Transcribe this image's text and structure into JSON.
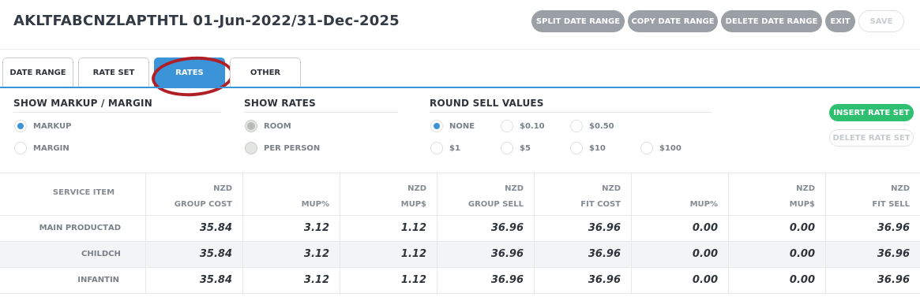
{
  "title": "AKLTFABCNZLAPTHTL 01-Jun-2022/31-Dec-2025",
  "actions": {
    "split": "SPLIT DATE RANGE",
    "copy": "COPY DATE RANGE",
    "delete": "DELETE DATE RANGE",
    "exit": "EXIT",
    "save": "SAVE"
  },
  "tabs": [
    "DATE RANGE",
    "RATE SET",
    "RATES",
    "OTHER"
  ],
  "active_tab": "RATES",
  "options": {
    "markup": {
      "heading": "SHOW MARKUP / MARGIN",
      "items": [
        "MARKUP",
        "MARGIN"
      ],
      "selected": "MARKUP"
    },
    "rates": {
      "heading": "SHOW RATES",
      "items": [
        "ROOM",
        "PER PERSON"
      ],
      "selected": "ROOM"
    },
    "round": {
      "heading": "ROUND SELL VALUES",
      "items": [
        "NONE",
        "$0.10",
        "$0.50",
        "$1",
        "$5",
        "$10",
        "$100"
      ],
      "selected": "NONE"
    }
  },
  "buttons": {
    "insert": "INSERT RATE SET",
    "delete": "DELETE RATE SET"
  },
  "table": {
    "service_header": "SERVICE ITEM",
    "columns": [
      {
        "currency": "NZD",
        "label": "GROUP COST"
      },
      {
        "currency": "",
        "label": "MUP%"
      },
      {
        "currency": "NZD",
        "label": "MUP$"
      },
      {
        "currency": "NZD",
        "label": "GROUP SELL"
      },
      {
        "currency": "NZD",
        "label": "FIT COST"
      },
      {
        "currency": "",
        "label": "MUP%"
      },
      {
        "currency": "NZD",
        "label": "MUP$"
      },
      {
        "currency": "NZD",
        "label": "FIT SELL"
      }
    ],
    "rows": [
      {
        "name": "MAIN PRODUCT",
        "code": "AD",
        "values": [
          "35.84",
          "3.12",
          "1.12",
          "36.96",
          "36.96",
          "0.00",
          "0.00",
          "36.96"
        ]
      },
      {
        "name": "CHILD",
        "code": "CH",
        "values": [
          "35.84",
          "3.12",
          "1.12",
          "36.96",
          "36.96",
          "0.00",
          "0.00",
          "36.96"
        ]
      },
      {
        "name": "INFANT",
        "code": "IN",
        "values": [
          "35.84",
          "3.12",
          "1.12",
          "36.96",
          "36.96",
          "0.00",
          "0.00",
          "36.96"
        ]
      }
    ]
  },
  "colors": {
    "accent": "#3b93d8",
    "insert": "#2fbf71",
    "action_pill": "#9ba0a6",
    "annotation": "#b01e26"
  }
}
